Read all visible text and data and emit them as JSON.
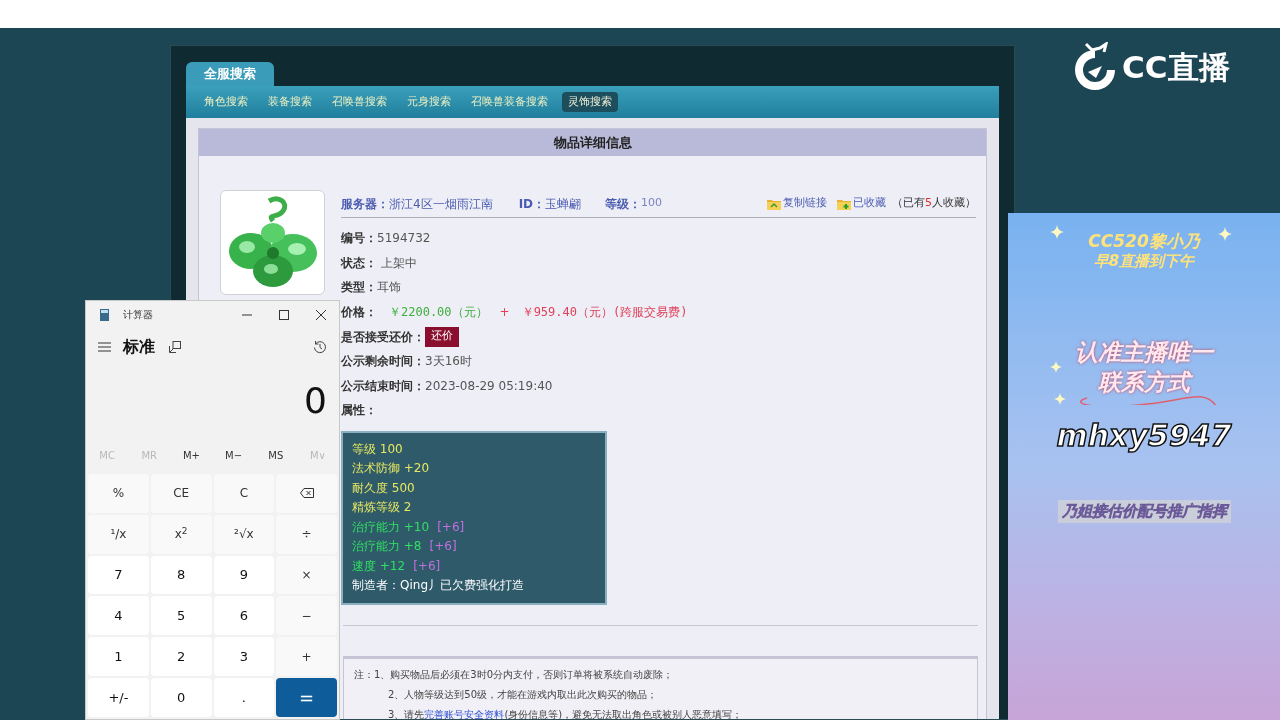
{
  "page": {
    "tabs": [
      {
        "label": "全服搜索",
        "selected": true
      }
    ],
    "nav": [
      {
        "label": "角色搜索",
        "selected": false
      },
      {
        "label": "装备搜索",
        "selected": false
      },
      {
        "label": "召唤兽搜索",
        "selected": false
      },
      {
        "label": "元身搜索",
        "selected": false
      },
      {
        "label": "召唤兽装备搜索",
        "selected": false
      },
      {
        "label": "灵饰搜索",
        "selected": true
      }
    ],
    "panel_title": "物品详细信息",
    "header": {
      "server_label": "服务器：",
      "server": "浙江4区一烟雨江南",
      "id_label": "ID：",
      "id": "玉蝉翩",
      "level_label": "等级：",
      "level": "100",
      "copy_link": "复制链接",
      "favorited": "已收藏",
      "favorites_prefix": "（已有",
      "favorites_count": "5",
      "favorites_suffix": "人收藏）"
    },
    "fields": [
      {
        "kind": "text",
        "label": "编号：",
        "value": "5194732"
      },
      {
        "kind": "text",
        "label": "状态：",
        "value": " 上架中"
      },
      {
        "kind": "text",
        "label": "类型：",
        "value": "耳饰"
      },
      {
        "kind": "price",
        "label": "价格：",
        "price": "￥2200.00（元）",
        "plus": "+",
        "fee": "￥959.40（元）(跨服交易费)"
      },
      {
        "kind": "button",
        "label": "是否接受还价：",
        "value": "还价"
      },
      {
        "kind": "text",
        "label": "公示剩余时间：",
        "value": "3天16时"
      },
      {
        "kind": "text",
        "label": "公示结束时间：",
        "value": "2023-08-29 05:19:40"
      },
      {
        "kind": "text",
        "label": "属性："
      }
    ],
    "attributes": [
      {
        "kind": "base",
        "text": "等级 100"
      },
      {
        "kind": "base",
        "text": "法术防御 +20"
      },
      {
        "kind": "base",
        "text": "耐久度 500"
      },
      {
        "kind": "base",
        "text": "精炼等级 2"
      },
      {
        "kind": "bonus",
        "text": "治疗能力 +10",
        "extra": "[+6]"
      },
      {
        "kind": "bonus",
        "text": "治疗能力 +8",
        "extra": "[+6]"
      },
      {
        "kind": "bonus",
        "text": "速度 +12",
        "extra": "[+6]"
      },
      {
        "kind": "maker",
        "text": "制造者：Qing丿已欠费强化打造"
      }
    ],
    "notes": [
      {
        "text": "注：1、购买物品后必须在3时0分内支付，否则订单将被系统自动废除；"
      },
      {
        "text": "2、人物等级达到50级，才能在游戏内取出此次购买的物品；"
      },
      {
        "text": "3、请先",
        "link": "完善账号安全资料",
        "after": "(身份信息等)，避免无法取出角色或被别人恶意填写；"
      }
    ]
  },
  "calculator": {
    "title": "计算器",
    "mode": "标准",
    "display": "0",
    "memory": [
      {
        "label": "MC",
        "disabled": true
      },
      {
        "label": "MR",
        "disabled": true
      },
      {
        "label": "M+",
        "disabled": false
      },
      {
        "label": "M−",
        "disabled": false
      },
      {
        "label": "MS",
        "disabled": false
      },
      {
        "label": "M∨",
        "disabled": true
      }
    ],
    "keys": [
      {
        "kind": "op",
        "label": "%"
      },
      {
        "kind": "op",
        "label": "CE"
      },
      {
        "kind": "op",
        "label": "C"
      },
      {
        "kind": "backspace"
      },
      {
        "kind": "op",
        "label": "¹/x"
      },
      {
        "kind": "op",
        "label": "x$^{2}$"
      },
      {
        "kind": "op",
        "label": "²√x"
      },
      {
        "kind": "op",
        "label": "÷"
      },
      {
        "kind": "digit",
        "label": "7"
      },
      {
        "kind": "digit",
        "label": "8"
      },
      {
        "kind": "digit",
        "label": "9"
      },
      {
        "kind": "op",
        "label": "×"
      },
      {
        "kind": "digit",
        "label": "4"
      },
      {
        "kind": "digit",
        "label": "5"
      },
      {
        "kind": "digit",
        "label": "6"
      },
      {
        "kind": "op",
        "label": "−"
      },
      {
        "kind": "digit",
        "label": "1"
      },
      {
        "kind": "digit",
        "label": "2"
      },
      {
        "kind": "digit",
        "label": "3"
      },
      {
        "kind": "op",
        "label": "+"
      },
      {
        "kind": "digit",
        "label": "+/-"
      },
      {
        "kind": "digit",
        "label": "0"
      },
      {
        "kind": "digit",
        "label": "."
      },
      {
        "kind": "equals",
        "label": "="
      }
    ]
  },
  "stream": {
    "logo": "CC直播",
    "banner": [
      "CC520黎小乃",
      "早8直播到下午"
    ],
    "headline": [
      "认准主播唯一",
      "联系方式"
    ],
    "contact": "mhxy5947",
    "footer": "乃姐接估价配号推广指挥"
  }
}
